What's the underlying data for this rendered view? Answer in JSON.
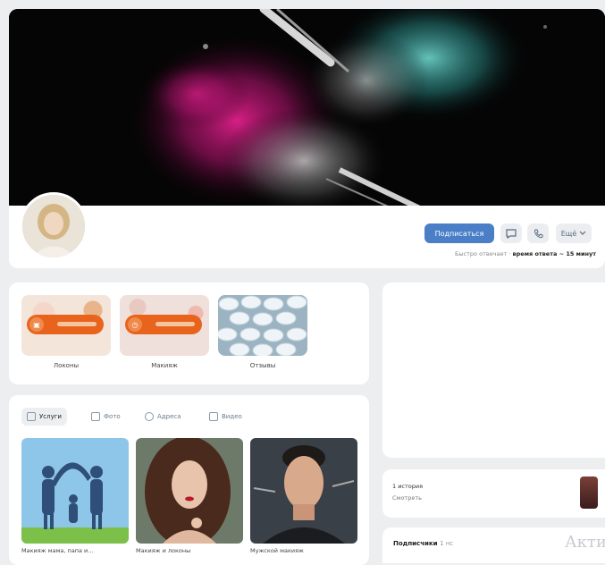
{
  "header": {
    "subscribe_label": "Подписаться",
    "more_label": "Ещё",
    "reply_prefix": "Быстро отвечает · ",
    "reply_value": "время ответа ~ 15 минут"
  },
  "icons": {
    "message": "chat-bubble",
    "call": "phone",
    "more": "chevron-down"
  },
  "services": {
    "items": [
      {
        "label": "Локоны",
        "button_icon": "calendar"
      },
      {
        "label": "Макияж",
        "button_icon": "clock"
      },
      {
        "label": "Отзывы"
      }
    ]
  },
  "tabs": [
    {
      "label": "Услуги",
      "active": true
    },
    {
      "label": "Фото"
    },
    {
      "label": "Адреса"
    },
    {
      "label": "Видео"
    }
  ],
  "gallery": {
    "captions": [
      "Макияж мама, папа и...",
      "Макияж и локоны",
      "Мужской макияж"
    ]
  },
  "sidebar": {
    "story_count": "1 история",
    "story_action": "Смотреть",
    "subscribers_label": "Подписчики",
    "subscribers_count": "1 нс",
    "active_label": "Акти"
  },
  "colors": {
    "accent": "#4a7fc7",
    "orange": "#e8641c",
    "background": "#edeef0"
  }
}
